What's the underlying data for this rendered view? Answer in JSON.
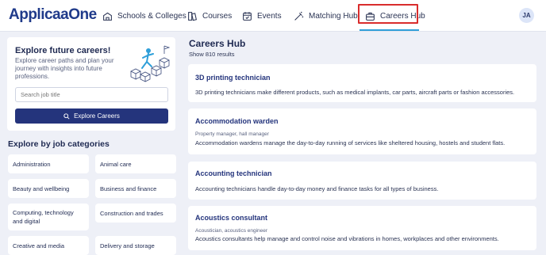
{
  "brand": {
    "name_main": "Applicaa",
    "name_accent": "One"
  },
  "nav": {
    "items": [
      {
        "label": "Schools & Colleges",
        "icon": "school-icon"
      },
      {
        "label": "Courses",
        "icon": "courses-icon"
      },
      {
        "label": "Events",
        "icon": "calendar-icon"
      },
      {
        "label": "Matching Hub",
        "icon": "magic-wand-icon"
      },
      {
        "label": "Careers Hub",
        "icon": "briefcase-icon",
        "active": true
      }
    ],
    "avatar": "JA",
    "active_color": "#d92c2c",
    "underline_color": "#2f9fd9"
  },
  "explore": {
    "title": "Explore future careers!",
    "description": "Explore career paths and plan your journey with insights into future professions.",
    "search_placeholder": "Search job title",
    "button_label": "Explore Careers",
    "button_color": "#24347c"
  },
  "categories": {
    "heading": "Explore by job categories",
    "items": [
      "Administration",
      "Animal care",
      "Beauty and wellbeing",
      "Business and finance",
      "Computing, technology and digital",
      "Construction and trades",
      "Creative and media",
      "Delivery and storage"
    ]
  },
  "hub": {
    "title": "Careers Hub",
    "count": "Show 810 results",
    "careers": [
      {
        "title": "3D printing technician",
        "alt": "",
        "desc": "3D printing technicians make different products, such as medical implants, car parts, aircraft parts or fashion accessories."
      },
      {
        "title": "Accommodation warden",
        "alt": "Property manager, hall manager",
        "desc": "Accommodation wardens manage the day-to-day running of services like sheltered housing, hostels and student flats."
      },
      {
        "title": "Accounting technician",
        "alt": "",
        "desc": "Accounting technicians handle day-to-day money and finance tasks for all types of business."
      },
      {
        "title": "Acoustics consultant",
        "alt": "Acoustician, acoustics engineer",
        "desc": "Acoustics consultants help manage and control noise and vibrations in homes, workplaces and other environments."
      }
    ]
  }
}
